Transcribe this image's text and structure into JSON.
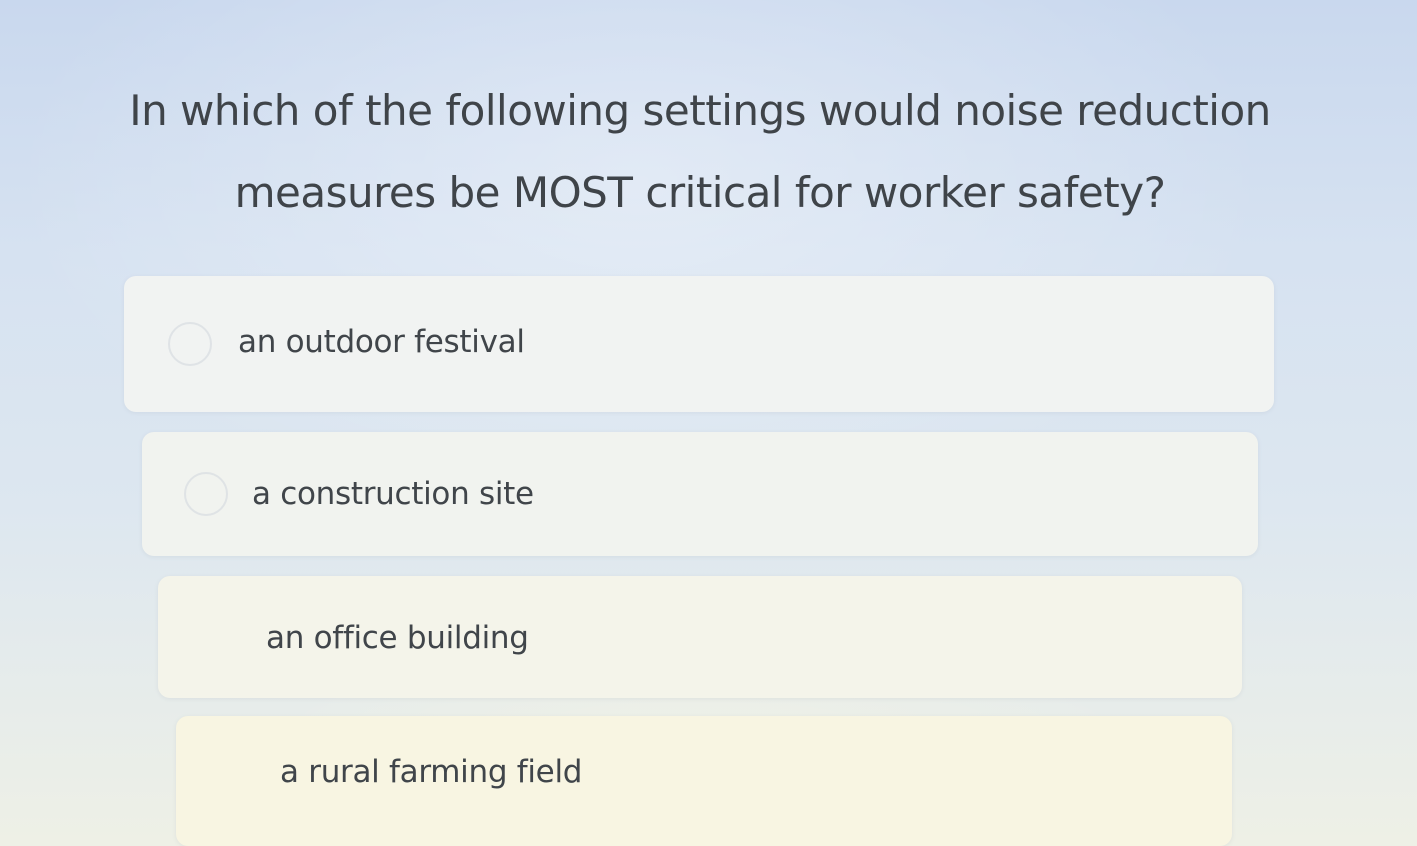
{
  "question": {
    "line1": "In which of the following settings would noise reduction",
    "line2": "measures be MOST critical for worker safety?"
  },
  "options": [
    {
      "label": "an outdoor festival"
    },
    {
      "label": "a construction site"
    },
    {
      "label": "an office building"
    },
    {
      "label": "a rural farming field"
    }
  ]
}
